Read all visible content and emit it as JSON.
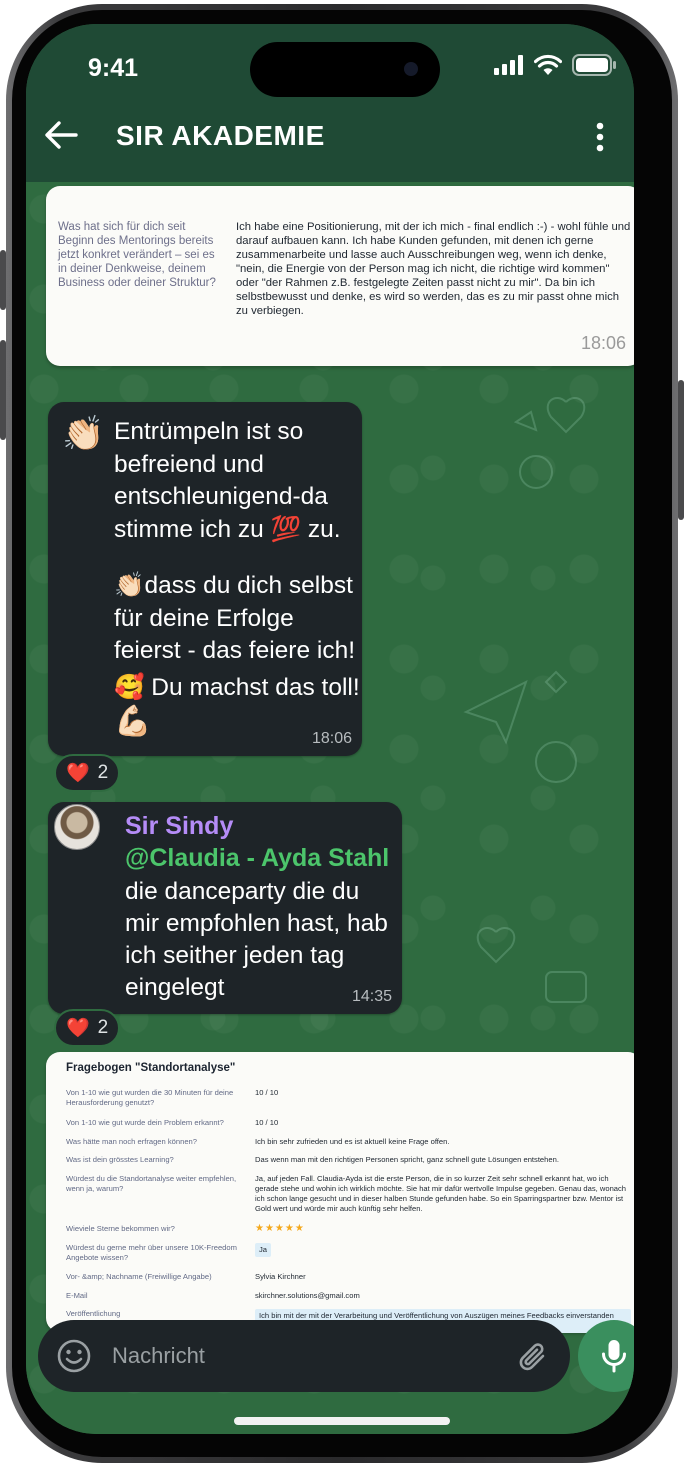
{
  "status_bar": {
    "time": "9:41"
  },
  "header": {
    "title": "SIR AKADEMIE"
  },
  "card1": {
    "question": "Was hat sich für dich seit Beginn des Mentorings bereits jetzt konkret verändert – sei es in deiner Denkweise, deinem Business oder deiner Struktur?",
    "answer": "Ich habe eine Positionierung, mit der ich mich - final endlich :-) - wohl fühle und darauf aufbauen kann. Ich habe Kunden gefunden, mit denen ich gerne zusammenarbeite und lasse auch Ausschreibungen weg, wenn ich denke, \"nein, die Energie von der Person mag ich nicht, die richtige wird kommen\" oder \"der Rahmen z.B. festgelegte Zeiten passt nicht zu mir\". Da bin ich selbstbewusst und denke, es wird so werden, das es zu mir passt ohne mich zu verbiegen.",
    "time": "18:06"
  },
  "message1": {
    "emoji_lead": "👏🏻",
    "line1": "Entrümpeln ist so befreiend und entschleunigend-da stimme ich zu 💯 zu.",
    "line2": "👏🏻dass du dich selbst für deine Erfolge feierst - das feiere ich!",
    "line3": "🥰 Du machst das toll!",
    "line4": "💪🏻",
    "time": "18:06",
    "reaction_emoji": "❤️",
    "reaction_count": "2"
  },
  "message2": {
    "sender": "Sir Sindy",
    "mention": "@Claudia - Ayda Stahl",
    "text": "die danceparty die du mir empfohlen hast, hab ich seither jeden tag eingelegt",
    "time": "14:35",
    "reaction_emoji": "❤️",
    "reaction_count": "2"
  },
  "card2": {
    "title": "Fragebogen \"Standortanalyse\"",
    "rows": [
      {
        "label": "Von 1-10 wie gut wurden die 30 Minuten für deine Herausforderung genutzt?",
        "value": "10 / 10"
      },
      {
        "label": "Von 1-10 wie gut wurde dein Problem erkannt?",
        "value": "10 / 10"
      },
      {
        "label": "Was hätte man noch erfragen können?",
        "value": "Ich bin sehr zufrieden und es ist aktuell keine Frage offen."
      },
      {
        "label": "Was ist dein grösstes Learning?",
        "value": "Das wenn man mit den richtigen Personen spricht, ganz schnell gute Lösungen entstehen."
      },
      {
        "label": "Würdest du die Standortanalyse weiter empfehlen, wenn ja, warum?",
        "value": "Ja, auf jeden Fall. Claudia-Ayda ist die erste Person, die in so kurzer Zeit sehr schnell erkannt hat, wo ich gerade stehe und wohin ich wirklich möchte. Sie hat mir dafür wertvolle Impulse gegeben. Genau das, wonach ich schon lange gesucht und in dieser halben Stunde gefunden habe. So ein Sparringspartner bzw. Mentor ist Gold wert und würde mir auch künftig sehr helfen."
      },
      {
        "label": "Wieviele Sterne bekommen wir?",
        "value": "★★★★★"
      },
      {
        "label": "Würdest du gerne mehr über unsere 10K-Freedom Angebote wissen?",
        "value": "Ja"
      },
      {
        "label": "Vor- &amp; Nachname (Freiwillige Angabe)",
        "value": "Sylvia Kirchner"
      },
      {
        "label": "E-Mail",
        "value": "skirchner.solutions@gmail.com"
      },
      {
        "label": "Veröffentlichung",
        "value": "Ich bin mit der mit der Verarbeitung und Veröffentlichung von Auszügen meines Feedbacks einverstanden (MIT Namen)"
      }
    ]
  },
  "composer": {
    "placeholder": "Nachricht"
  },
  "colors": {
    "header": "#1f4a35",
    "chat_bg": "#2f6b40",
    "bubble": "#1e2428",
    "sender": "#b58cf7",
    "mention": "#4cc56b",
    "mic": "#3a8f5e"
  },
  "icons": [
    "back-arrow-icon",
    "more-vertical-icon",
    "emoji-icon",
    "attach-icon",
    "mic-icon",
    "signal-icon",
    "wifi-icon",
    "battery-icon",
    "heart-icon"
  ]
}
